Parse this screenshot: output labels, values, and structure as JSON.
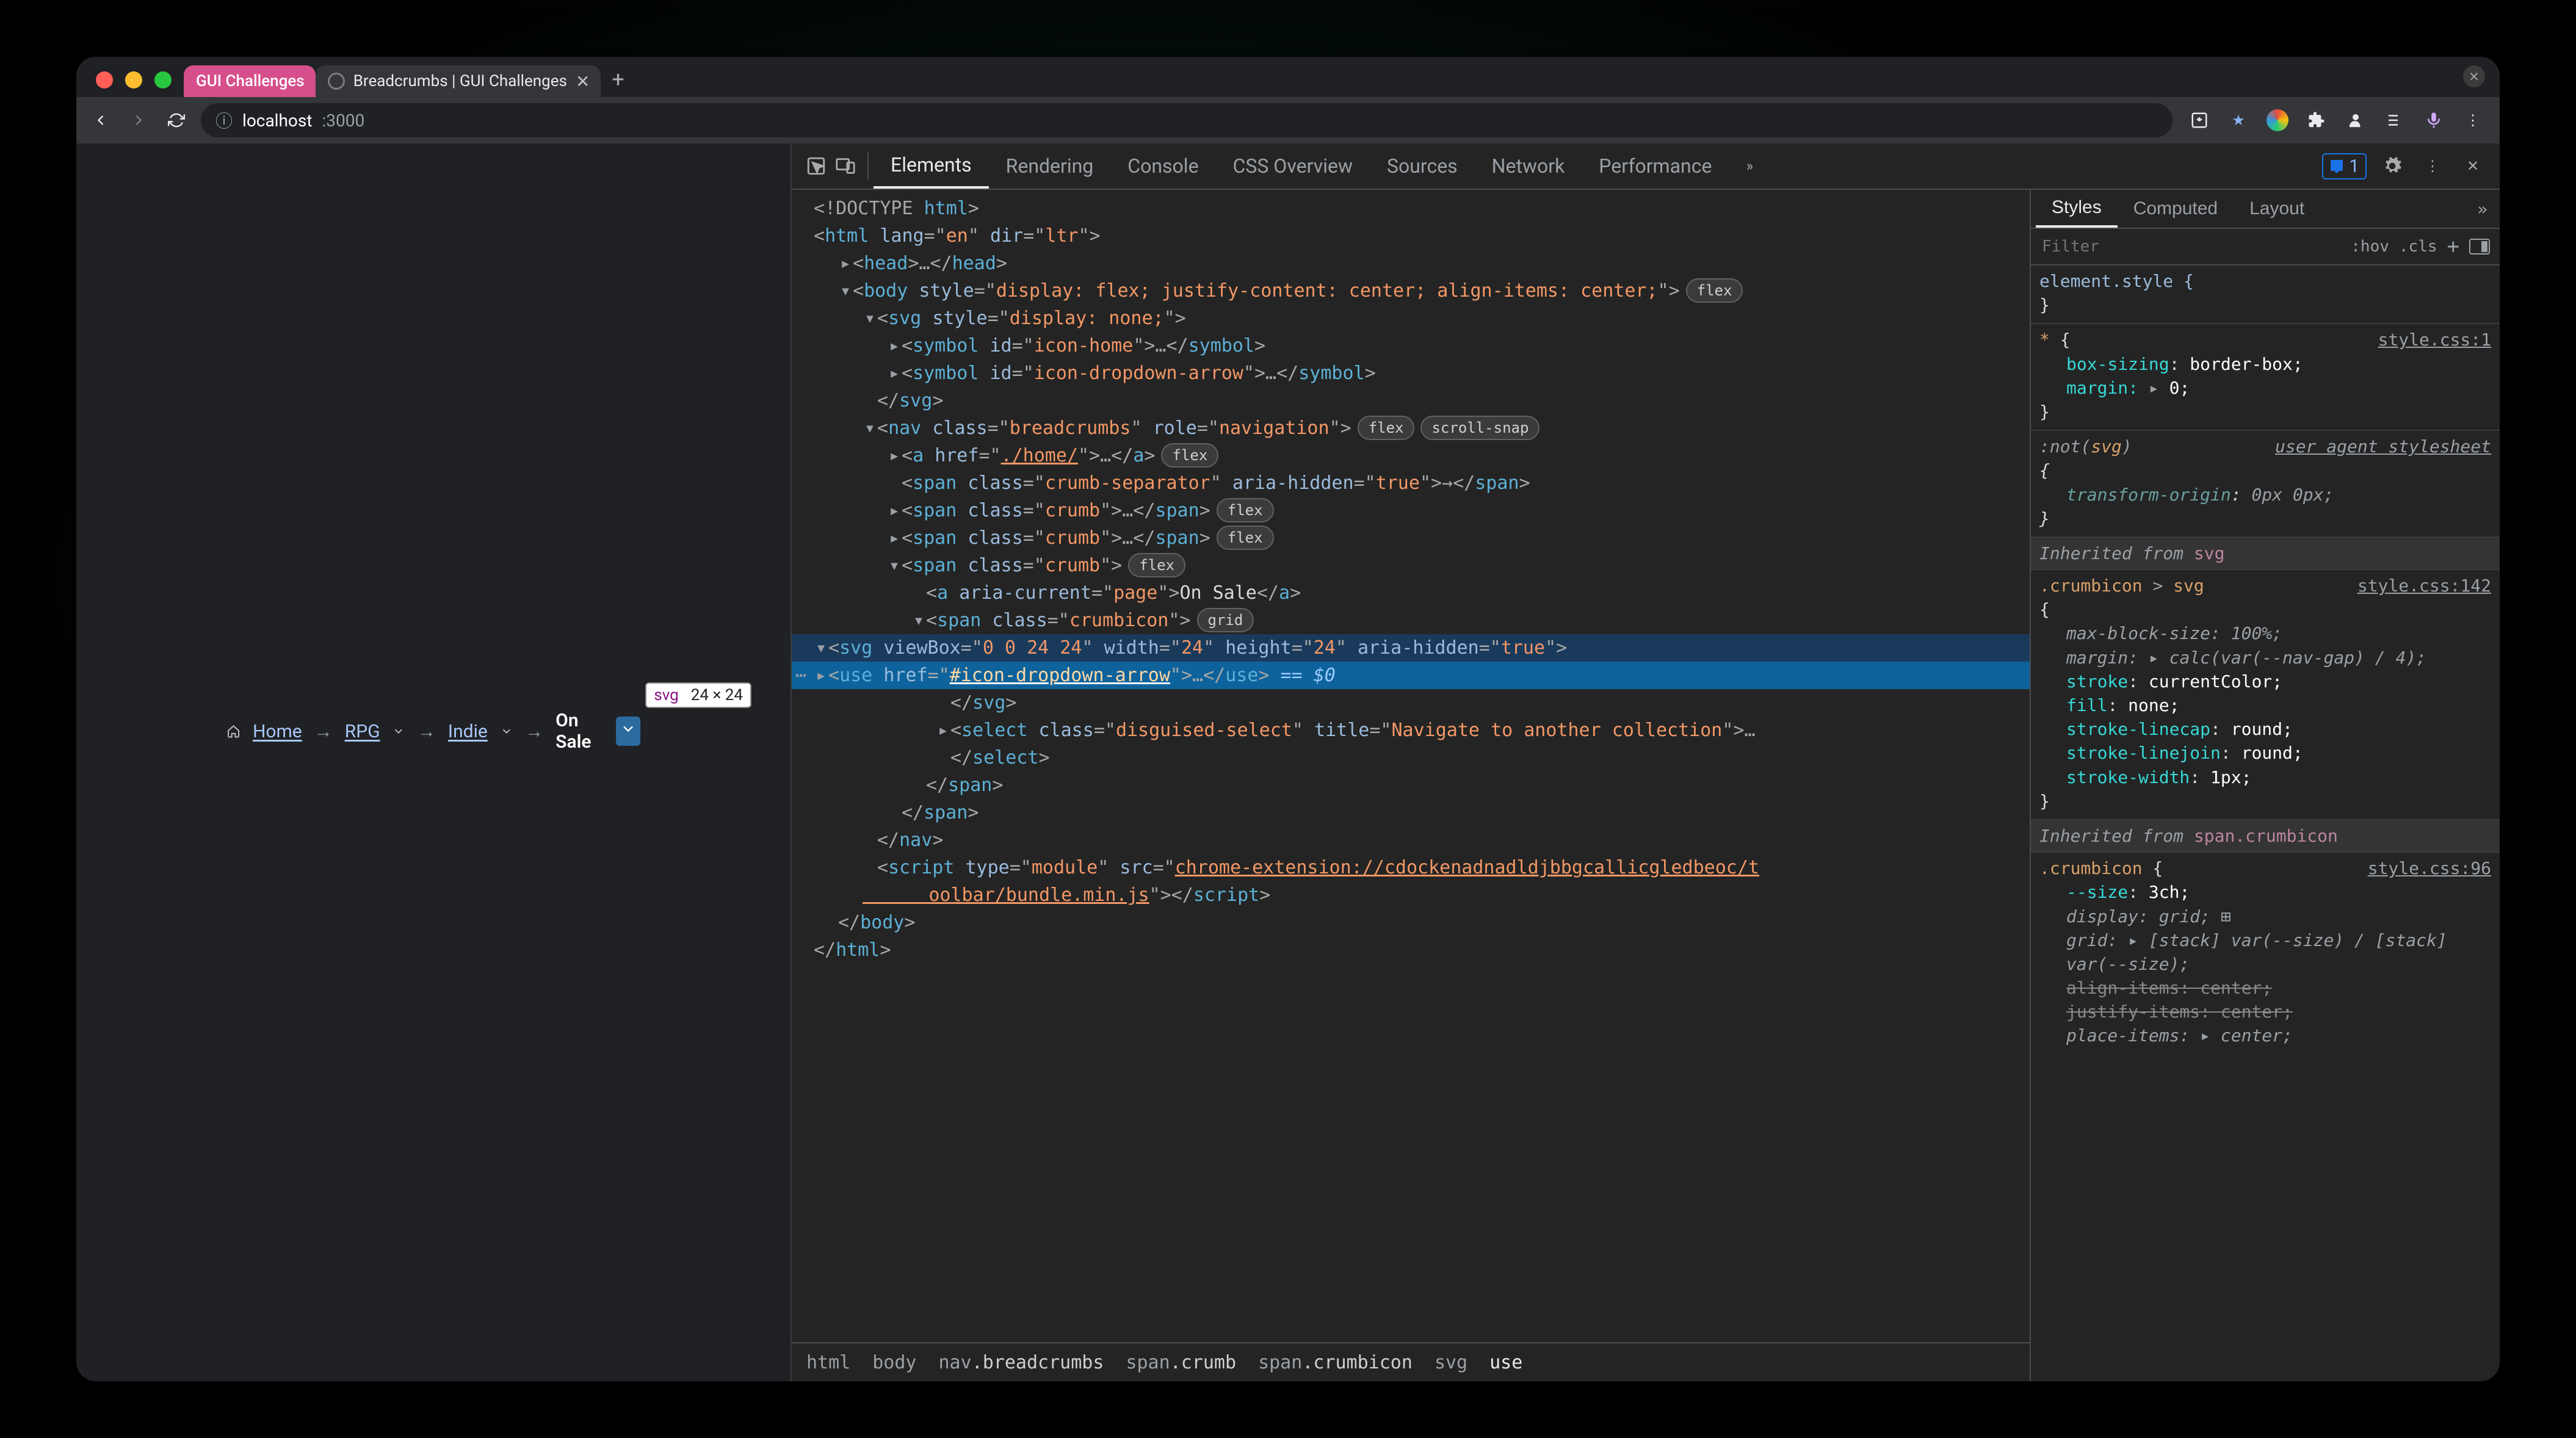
{
  "tabs": {
    "pinned": "GUI Challenges",
    "active_title": "Breadcrumbs | GUI Challenges"
  },
  "url": {
    "host": "localhost",
    "port": ":3000",
    "info_icon": "ⓘ"
  },
  "page": {
    "home": "Home",
    "rpg": "RPG",
    "indie": "Indie",
    "onsale": "On Sale",
    "tooltip_tag": "svg",
    "tooltip_dims": "24 × 24"
  },
  "devtools": {
    "tabs": [
      "Elements",
      "Rendering",
      "Console",
      "CSS Overview",
      "Sources",
      "Network",
      "Performance"
    ],
    "issue_count": "1",
    "styles_tabs": [
      "Styles",
      "Computed",
      "Layout"
    ],
    "filter_placeholder": "Filter",
    "hov": ":hov",
    "cls": ".cls"
  },
  "dom": {
    "doctype": "<!DOCTYPE html>",
    "html_open": "<html lang=\"en\" dir=\"ltr\">",
    "head": "<head>…</head>",
    "body_open": "<body style=\"display: flex; justify-content: center; align-items: center;\">",
    "body_badge": "flex",
    "svg_open": "<svg style=\"display: none;\">",
    "symbol1": "<symbol id=\"icon-home\">…</symbol>",
    "symbol2": "<symbol id=\"icon-dropdown-arrow\">…</symbol>",
    "svg_close": "</svg>",
    "nav_open": "<nav class=\"breadcrumbs\" role=\"navigation\">",
    "nav_badges": [
      "flex",
      "scroll-snap"
    ],
    "a_home": "<a href=\"./home/\">…</a>",
    "a_home_badge": "flex",
    "sep": "<span class=\"crumb-separator\" aria-hidden=\"true\">→</span>",
    "crumb1": "<span class=\"crumb\">…</span>",
    "crumb_badge": "flex",
    "crumb2": "<span class=\"crumb\">…</span>",
    "crumb_open": "<span class=\"crumb\">",
    "a_current": "<a aria-current=\"page\">On Sale</a>",
    "crumbicon_open": "<span class=\"crumbicon\">",
    "crumbicon_badge": "grid",
    "svg24_open": "<svg viewBox=\"0 0 24 24\" width=\"24\" height=\"24\" aria-hidden=\"true\">",
    "use_line": "<use href=\"#icon-dropdown-arrow\">…</use>",
    "use_suffix": " == $0",
    "svg24_close": "</svg>",
    "select_open": "<select class=\"disguised-select\" title=\"Navigate to another collection\">…",
    "select_close": "</select>",
    "span_close": "</span>",
    "nav_close": "</nav>",
    "script_line": "<script type=\"module\" src=\"chrome-extension://cdockenadnadldjbbgcallicgledbeoc/toolbar/bundle.min.js\"></script>",
    "body_close": "</body>",
    "html_close": "</html>"
  },
  "dom_path": [
    "html",
    "body",
    "nav.breadcrumbs",
    "span.crumb",
    "span.crumbicon",
    "svg",
    "use"
  ],
  "styles": {
    "elem": {
      "sel": "element.style {",
      "close": "}"
    },
    "star": {
      "sel": "* {",
      "src": "style.css:1",
      "box": "box-sizing",
      "boxv": "border-box;",
      "margin": "margin:",
      "marginv": "0;"
    },
    "notsvg": {
      "sel": ":not(svg)",
      "note": "user agent stylesheet",
      "decl1": "transform-origin",
      "decl1v": "0px 0px;"
    },
    "inherit_svg": "Inherited from",
    "inherit_svg_kw": "svg",
    "crumb_svg": {
      "sel": ".crumbicon > svg",
      "src": "style.css:142",
      "p1": "max-block-size",
      "v1": "100%;",
      "p2": "margin:",
      "v2": "calc(var(--nav-gap) / 4);",
      "p3": "stroke",
      "v3": "currentColor;",
      "p4": "fill",
      "v4": "none;",
      "p5": "stroke-linecap",
      "v5": "round;",
      "p6": "stroke-linejoin",
      "v6": "round;",
      "p7": "stroke-width",
      "v7": "1px;"
    },
    "inherit_span": "Inherited from",
    "inherit_span_kw": "span.crumbicon",
    "crumbicon": {
      "sel": ".crumbicon {",
      "src": "style.css:96",
      "p1": "--size",
      "v1": "3ch;",
      "p2": "display",
      "v2": "grid;",
      "p3": "grid:",
      "v3": "[stack] var(--size) / [stack] var(--size);",
      "p4": "align-items",
      "v4": "center;",
      "p5": "justify-items",
      "v5": "center;",
      "p6": "place-items:",
      "v6": "center;"
    }
  }
}
